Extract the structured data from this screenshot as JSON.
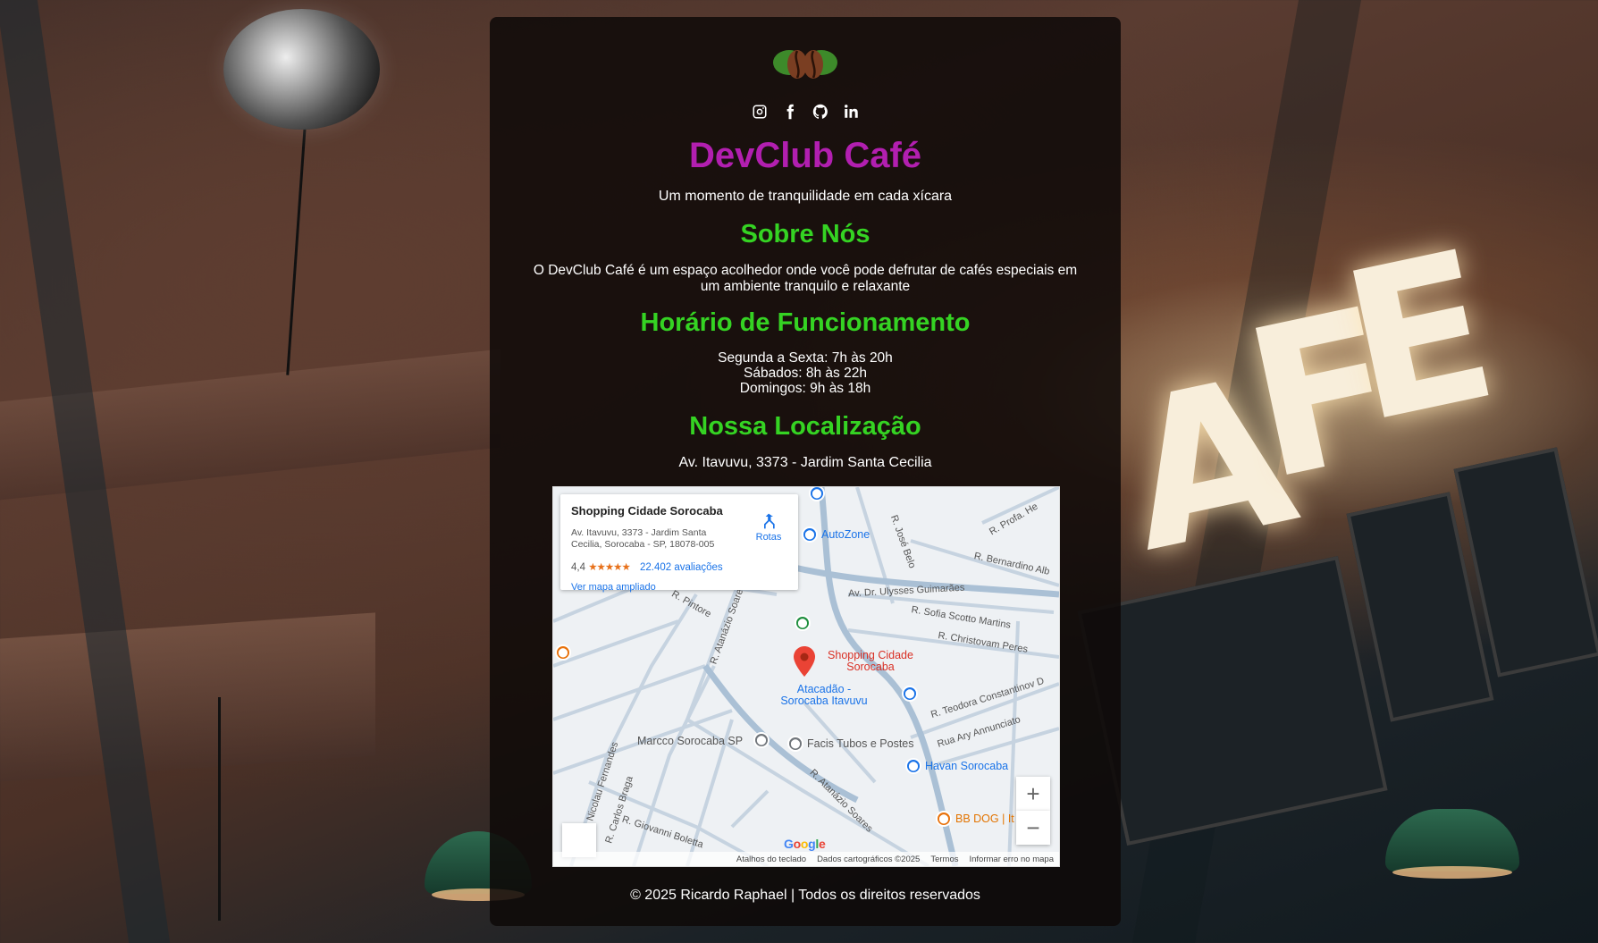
{
  "site": {
    "title": "DevClub Café",
    "tagline": "Um momento de tranquilidade em cada xícara",
    "logo_icon": "coffee-beans-leaf-icon",
    "colors": {
      "title": "#b21fb0",
      "heading": "#35d323",
      "card_bg": "rgba(14,9,8,0.86)"
    }
  },
  "socials": [
    {
      "name": "instagram-icon"
    },
    {
      "name": "facebook-icon"
    },
    {
      "name": "github-icon"
    },
    {
      "name": "linkedin-icon"
    }
  ],
  "about": {
    "heading": "Sobre Nós",
    "text": "O DevClub Café é um espaço acolhedor onde você pode defrutar de cafés especiais em um ambiente tranquilo e relaxante"
  },
  "hours": {
    "heading": "Horário de Funcionamento",
    "lines": [
      "Segunda a Sexta: 7h às 20h",
      "Sábados: 8h às 22h",
      "Domingos: 9h às 18h"
    ]
  },
  "location": {
    "heading": "Nossa Localização",
    "address": "Av. Itavuvu, 3373 - Jardim Santa Cecilia"
  },
  "map": {
    "card": {
      "name": "Shopping Cidade Sorocaba",
      "address": "Av. Itavuvu, 3373 - Jardim Santa Cecilia, Sorocaba - SP, 18078-005",
      "rating": "4,4",
      "stars": "★★★★★",
      "reviews": "22.402 avaliações",
      "link": "Ver mapa ampliado",
      "directions": "Rotas"
    },
    "places": {
      "main": "Shopping Cidade Sorocaba",
      "autozone": "AutoZone",
      "atacadao": "Atacadão - Sorocaba Itavuvu",
      "marcco": "Marcco Sorocaba SP",
      "facis": "Facis Tubos e Postes",
      "havan": "Havan Sorocaba",
      "bbdog": "BB DOG | It"
    },
    "streets": {
      "jose_belo": "R. José Belo",
      "profa": "R. Profa. He",
      "bernardino": "R. Bernardino Alb",
      "ulysses": "Av. Dr. Ulysses Guimarães",
      "sofia": "R. Sofia Scotto Martins",
      "christovam": "R. Christovam Peres",
      "pintore": "R. Pintore",
      "atanazio1": "R. Atanázio Soare",
      "teodora": "R. Teodora Constantinov D",
      "ary": "Rua Ary Annunciato",
      "nicolau": "R. Nicolau Fernandes",
      "carlos": "R. Carlos Braga",
      "giovanni": "R. Giovanni Boletta",
      "atanazio2": "R. Atanázio Soares"
    },
    "controls": {
      "zoom_in": "+",
      "zoom_out": "−"
    },
    "google": "Google",
    "attribution": [
      "Atalhos do teclado",
      "Dados cartográficos ©2025",
      "Termos",
      "Informar erro no mapa"
    ]
  },
  "footer": "© 2025 Ricardo Raphael | Todos os direitos reservados"
}
